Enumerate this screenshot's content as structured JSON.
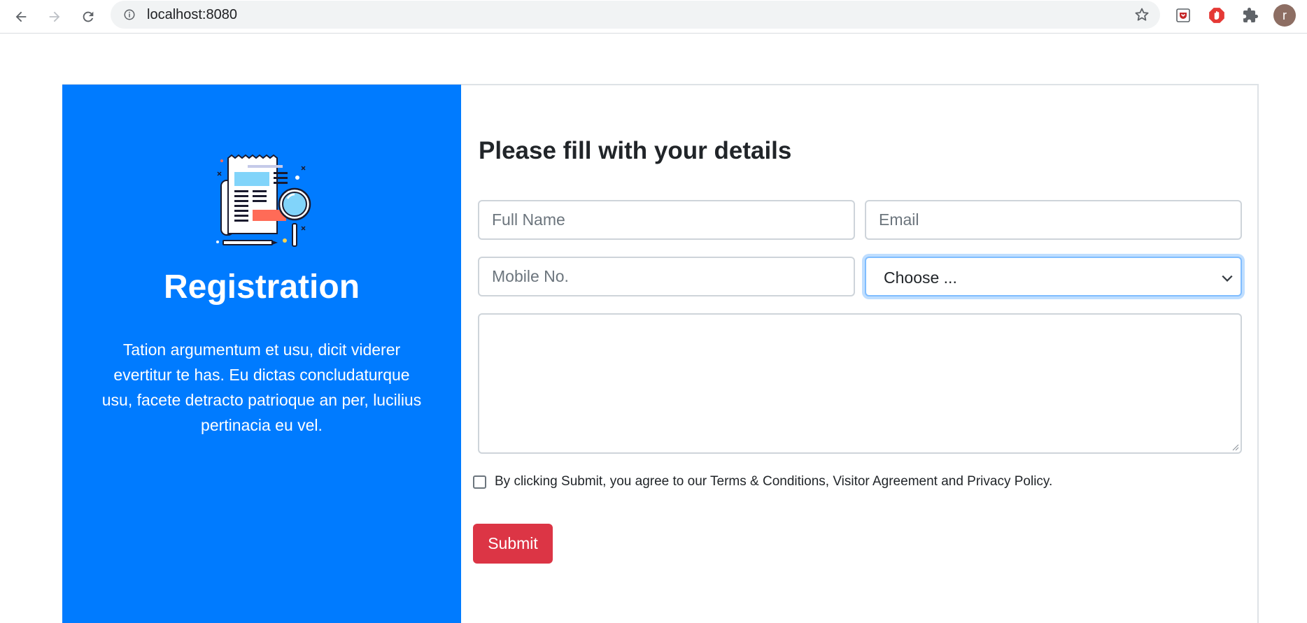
{
  "browser": {
    "url": "localhost:8080",
    "avatar_letter": "r",
    "icons": [
      "back-arrow-icon",
      "forward-arrow-icon",
      "reload-icon",
      "site-info-icon",
      "bookmark-star-icon",
      "pocket-extension-icon",
      "adblock-extension-icon",
      "extensions-puzzle-icon"
    ]
  },
  "left_panel": {
    "title": "Registration",
    "description": "Tation argumentum et usu, dicit viderer evertitur te has. Eu dictas concludaturque usu, facete detracto patrioque an per, lucilius pertinacia eu vel.",
    "illustration": "newspaper-magnifier-illustration",
    "color": "#007bff"
  },
  "form": {
    "heading": "Please fill with your details",
    "full_name_placeholder": "Full Name",
    "email_placeholder": "Email",
    "mobile_placeholder": "Mobile No.",
    "select_value": "Choose ...",
    "message_value": "",
    "agree_text": "By clicking Submit, you agree to our Terms & Conditions, Visitor Agreement and Privacy Policy.",
    "agree_checked": false,
    "submit_label": "Submit",
    "submit_color": "#dc3545"
  }
}
